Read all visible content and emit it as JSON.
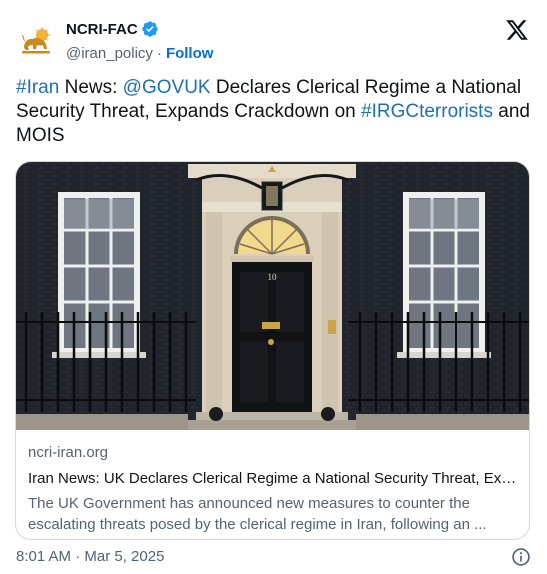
{
  "account": {
    "display_name": "NCRI-FAC",
    "handle": "@iran_policy",
    "separator": "·",
    "follow_label": "Follow",
    "verified": true
  },
  "tweet": {
    "hashtag_iran": "#Iran",
    "text_1": " News: ",
    "mention": "@GOVUK",
    "text_2": " Declares Clerical Regime a National Security Threat, Expands Crackdown on ",
    "hashtag_irgc": "#IRGCterrorists",
    "text_3": " and MOIS"
  },
  "card": {
    "image_door_number": "10",
    "domain": "ncri-iran.org",
    "title": "Iran News: UK Declares Clerical Regime a National Security Threat, Expands Crackdown on IRGC and MOIS",
    "description": "The UK Government has announced new measures to counter the escalating threats posed by the clerical regime in Iran, following an ..."
  },
  "footer": {
    "timestamp": "8:01 AM · Mar 5, 2025"
  },
  "colors": {
    "link": "#1d6fb8",
    "follow": "#006fd6",
    "verified": "#1d9bf0",
    "muted": "#536471",
    "border": "#cfd9de"
  }
}
